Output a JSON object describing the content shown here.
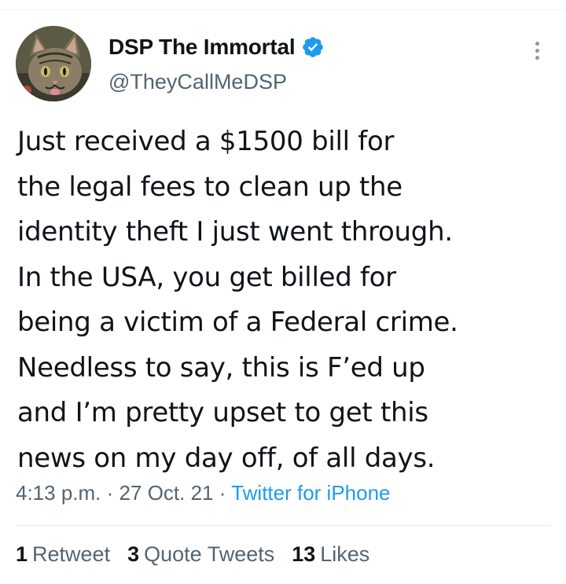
{
  "author": {
    "display_name": "DSP The Immortal",
    "handle": "@TheyCallMeDSP",
    "verified": true,
    "avatar_icon": "cat-avatar"
  },
  "tweet": {
    "lines": [
      "Just received a $1500 bill for",
      "the legal fees to clean up the",
      "identity theft I just went through.",
      "In the USA, you get billed for",
      "being a victim of a Federal crime.",
      "Needless to say, this is F’ed up",
      "and I’m pretty upset to get this",
      "news on my day off, of all days."
    ]
  },
  "meta": {
    "time": "4:13 p.m.",
    "separator": "·",
    "date": "27 Oct. 21",
    "source": "Twitter for iPhone"
  },
  "stats": {
    "retweets_count": "1",
    "retweets_label": "Retweet",
    "quotes_count": "3",
    "quotes_label": "Quote Tweets",
    "likes_count": "13",
    "likes_label": "Likes"
  },
  "colors": {
    "accent": "#1d9bf0",
    "text_primary": "#0f1419",
    "text_secondary": "#536471"
  }
}
